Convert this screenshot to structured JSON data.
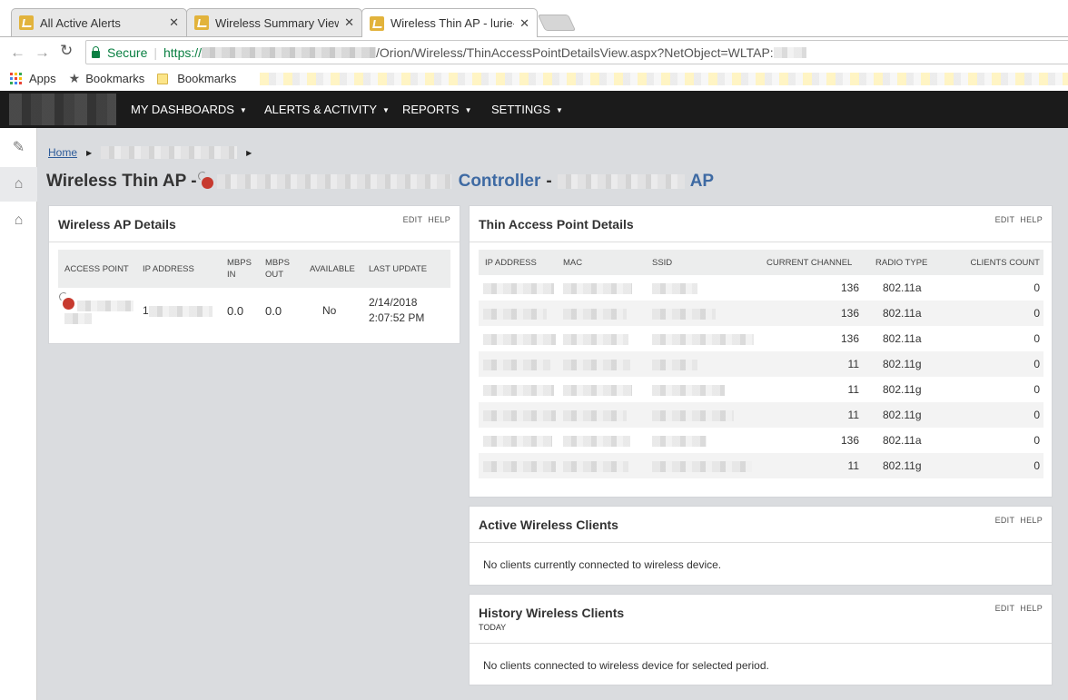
{
  "browser": {
    "tabs": [
      {
        "title": "All Active Alerts"
      },
      {
        "title": "Wireless Summary View"
      },
      {
        "title": "Wireless Thin AP - lurie-"
      }
    ],
    "secure_label": "Secure",
    "url_protocol": "https://",
    "url_path": "/Orion/Wireless/ThinAccessPointDetailsView.aspx?NetObject=WLTAP:",
    "bookmarks": {
      "apps_label": "Apps",
      "bookmarks_star_label": "Bookmarks",
      "bookmarks_folder_label": "Bookmarks"
    }
  },
  "nav": {
    "items": [
      {
        "label": "MY DASHBOARDS"
      },
      {
        "label": "ALERTS & ACTIVITY"
      },
      {
        "label": "REPORTS"
      },
      {
        "label": "SETTINGS"
      }
    ]
  },
  "breadcrumb": {
    "home": "Home"
  },
  "page": {
    "title_prefix": "Wireless Thin AP -",
    "controller_label": "Controller",
    "dash": "-",
    "ap_label": "AP"
  },
  "panel_actions": {
    "edit": "EDIT",
    "help": "HELP"
  },
  "ap_details": {
    "title": "Wireless AP Details",
    "columns": {
      "access_point": "ACCESS POINT",
      "ip_address": "IP ADDRESS",
      "mbps_in_1": "MBPS",
      "mbps_in_2": "IN",
      "mbps_out_1": "MBPS",
      "mbps_out_2": "OUT",
      "available": "AVAILABLE",
      "last_update": "LAST UPDATE"
    },
    "row": {
      "ip_prefix": "1",
      "mbps_in": "0.0",
      "mbps_out": "0.0",
      "available": "No",
      "last_update_date": "2/14/2018",
      "last_update_time": "2:07:52 PM"
    }
  },
  "thin_ap": {
    "title": "Thin Access Point Details",
    "columns": {
      "ip_address": "IP ADDRESS",
      "mac": "MAC",
      "ssid": "SSID",
      "current_channel": "CURRENT CHANNEL",
      "radio_type": "RADIO TYPE",
      "clients_count": "CLIENTS COUNT"
    },
    "rows": [
      {
        "channel": "136",
        "radio": "802.11a",
        "clients": "0"
      },
      {
        "channel": "136",
        "radio": "802.11a",
        "clients": "0"
      },
      {
        "channel": "136",
        "radio": "802.11a",
        "clients": "0"
      },
      {
        "channel": "11",
        "radio": "802.11g",
        "clients": "0"
      },
      {
        "channel": "11",
        "radio": "802.11g",
        "clients": "0"
      },
      {
        "channel": "11",
        "radio": "802.11g",
        "clients": "0"
      },
      {
        "channel": "136",
        "radio": "802.11a",
        "clients": "0"
      },
      {
        "channel": "11",
        "radio": "802.11g",
        "clients": "0"
      }
    ]
  },
  "active_clients": {
    "title": "Active Wireless Clients",
    "message": "No clients currently connected to wireless device."
  },
  "history_clients": {
    "title": "History Wireless Clients",
    "subtitle": "TODAY",
    "message": "No clients connected to wireless device for selected period."
  },
  "colors": {
    "nav_bg": "#1b1b1b",
    "link_blue": "#3e6aa3",
    "status_red": "#c73a2f",
    "tab_icon": "#e2b33c"
  }
}
